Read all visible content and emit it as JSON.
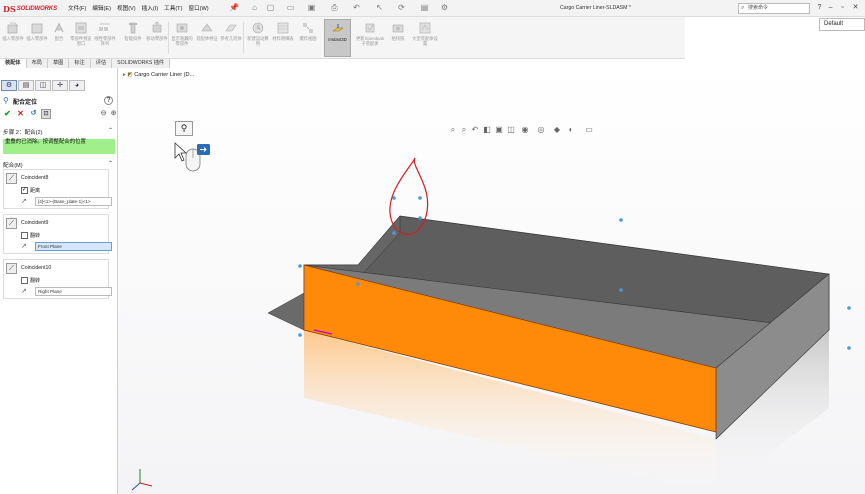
{
  "app": {
    "brand_ds": "DS",
    "brand_name": "SOLIDWORKS",
    "document_title": "Cargo Carrier Liner-SLDASM *",
    "search_placeholder": "搜索命令",
    "config_name": "Default"
  },
  "menu": [
    "文件(F)",
    "编辑(E)",
    "视图(V)",
    "插入(I)",
    "工具(T)",
    "窗口(W)"
  ],
  "quick_access": [
    "home-icon",
    "new-icon",
    "open-icon",
    "save-icon",
    "print-icon",
    "undo-icon",
    "select-icon",
    "rebuild-icon",
    "options-icon"
  ],
  "ribbon": [
    {
      "label": "插入零部件",
      "icon": "insert-component-icon"
    },
    {
      "label": "插入零部件",
      "icon": "insert-component-icon"
    },
    {
      "label": "配合",
      "icon": "mate-icon"
    },
    {
      "label": "零部件预览窗口",
      "icon": "preview-window-icon"
    },
    {
      "label": "线性零部件阵列",
      "icon": "linear-pattern-icon"
    },
    {
      "label": "智能扣件",
      "icon": "smart-fastener-icon"
    },
    {
      "label": "移动零部件",
      "icon": "move-component-icon"
    },
    {
      "label": "显示隐藏的零部件",
      "icon": "show-hidden-icon"
    },
    {
      "label": "装配体特征",
      "icon": "assembly-feature-icon"
    },
    {
      "label": "参考几何体",
      "icon": "reference-geometry-icon"
    },
    {
      "label": "新建运动算例",
      "icon": "motion-study-icon"
    },
    {
      "label": "材料明细表",
      "icon": "bom-icon"
    },
    {
      "label": "爆炸视图",
      "icon": "exploded-view-icon"
    },
    {
      "label": "Instant3D",
      "icon": "instant3d-icon"
    },
    {
      "label": "更新Speedpak子装配体",
      "icon": "speedpak-icon"
    },
    {
      "label": "拍快照",
      "icon": "snapshot-icon"
    },
    {
      "label": "大型装配体设置",
      "icon": "large-assembly-icon"
    }
  ],
  "tabs": [
    "装配体",
    "布局",
    "草图",
    "标注",
    "评估",
    "SOLIDWORKS 插件"
  ],
  "panel": {
    "title": "配合定位",
    "step_text": "步骤 2：配合(2)",
    "message": "重叠的已消除。按调整配合的位置",
    "mates_header": "配合(M)",
    "mates": [
      {
        "name": "Coincident8",
        "checkbox_label": "距离",
        "checked": true,
        "field": "[4]<1>-(Base_plate-1)<1>",
        "selected": false
      },
      {
        "name": "Coincident9",
        "checkbox_label": "翻转",
        "checked": false,
        "field": "Front Plane",
        "selected": true
      },
      {
        "name": "Coincident10",
        "checkbox_label": "翻转",
        "checked": false,
        "field": "Right Plane",
        "selected": false
      }
    ]
  },
  "viewport": {
    "tree_root": "Cargo Carrier Liner (D..."
  },
  "colors": {
    "accent_orange": "#ff8a0a",
    "message_green": "#9ff08a",
    "brand_red": "#d0202a",
    "sketch_red": "#d21e24"
  }
}
